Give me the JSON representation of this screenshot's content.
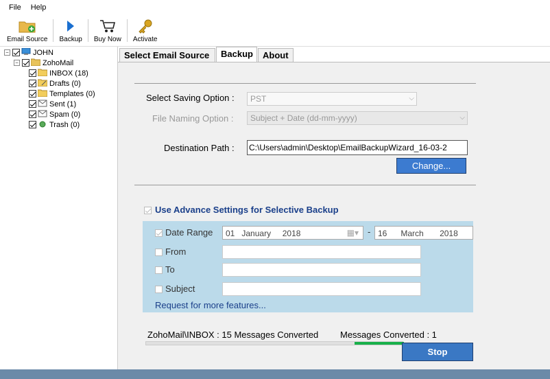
{
  "menu": {
    "file": "File",
    "help": "Help"
  },
  "toolbar": {
    "email_source": "Email Source",
    "backup": "Backup",
    "buy_now": "Buy Now",
    "activate": "Activate"
  },
  "tree": {
    "root": "JOHN",
    "account": "ZohoMail",
    "folders": [
      "INBOX (18)",
      "Drafts (0)",
      "Templates (0)",
      "Sent (1)",
      "Spam (0)",
      "Trash (0)"
    ]
  },
  "tabs": [
    "Select Email Source",
    "Backup",
    "About"
  ],
  "backup": {
    "saving_option_label": "Select Saving Option :",
    "saving_option_value": "PST",
    "file_naming_label": "File Naming Option :",
    "file_naming_value": "Subject + Date (dd-mm-yyyy)",
    "destination_label": "Destination Path :",
    "destination_value": "C:\\Users\\admin\\Desktop\\EmailBackupWizard_16-03-2",
    "change_button": "Change...",
    "advance_label": "Use Advance Settings for Selective Backup",
    "date_range_label": "Date Range",
    "date_from": {
      "day": "01",
      "month": "January",
      "year": "2018"
    },
    "date_to": {
      "day": "16",
      "month": "March",
      "year": "2018"
    },
    "date_separator": "-",
    "from_label": "From",
    "to_label": "To",
    "subject_label": "Subject",
    "more_features": "Request for more features...",
    "status_text": "ZohoMail\\INBOX : 15 Messages Converted",
    "messages_converted": "Messages Converted : 1",
    "stop_button": "Stop"
  },
  "colors": {
    "accent_button": "#3c7bd0",
    "progress": "#18b04a",
    "advanced_panel": "#bbdaea"
  }
}
